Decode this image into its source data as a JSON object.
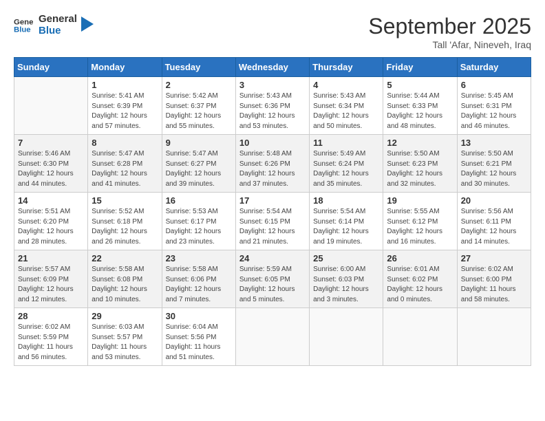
{
  "header": {
    "logo_line1": "General",
    "logo_line2": "Blue",
    "month": "September 2025",
    "location": "Tall 'Afar, Nineveh, Iraq"
  },
  "weekdays": [
    "Sunday",
    "Monday",
    "Tuesday",
    "Wednesday",
    "Thursday",
    "Friday",
    "Saturday"
  ],
  "weeks": [
    [
      {
        "day": null
      },
      {
        "day": 1,
        "info": "Sunrise: 5:41 AM\nSunset: 6:39 PM\nDaylight: 12 hours\nand 57 minutes."
      },
      {
        "day": 2,
        "info": "Sunrise: 5:42 AM\nSunset: 6:37 PM\nDaylight: 12 hours\nand 55 minutes."
      },
      {
        "day": 3,
        "info": "Sunrise: 5:43 AM\nSunset: 6:36 PM\nDaylight: 12 hours\nand 53 minutes."
      },
      {
        "day": 4,
        "info": "Sunrise: 5:43 AM\nSunset: 6:34 PM\nDaylight: 12 hours\nand 50 minutes."
      },
      {
        "day": 5,
        "info": "Sunrise: 5:44 AM\nSunset: 6:33 PM\nDaylight: 12 hours\nand 48 minutes."
      },
      {
        "day": 6,
        "info": "Sunrise: 5:45 AM\nSunset: 6:31 PM\nDaylight: 12 hours\nand 46 minutes."
      }
    ],
    [
      {
        "day": 7,
        "info": "Sunrise: 5:46 AM\nSunset: 6:30 PM\nDaylight: 12 hours\nand 44 minutes."
      },
      {
        "day": 8,
        "info": "Sunrise: 5:47 AM\nSunset: 6:28 PM\nDaylight: 12 hours\nand 41 minutes."
      },
      {
        "day": 9,
        "info": "Sunrise: 5:47 AM\nSunset: 6:27 PM\nDaylight: 12 hours\nand 39 minutes."
      },
      {
        "day": 10,
        "info": "Sunrise: 5:48 AM\nSunset: 6:26 PM\nDaylight: 12 hours\nand 37 minutes."
      },
      {
        "day": 11,
        "info": "Sunrise: 5:49 AM\nSunset: 6:24 PM\nDaylight: 12 hours\nand 35 minutes."
      },
      {
        "day": 12,
        "info": "Sunrise: 5:50 AM\nSunset: 6:23 PM\nDaylight: 12 hours\nand 32 minutes."
      },
      {
        "day": 13,
        "info": "Sunrise: 5:50 AM\nSunset: 6:21 PM\nDaylight: 12 hours\nand 30 minutes."
      }
    ],
    [
      {
        "day": 14,
        "info": "Sunrise: 5:51 AM\nSunset: 6:20 PM\nDaylight: 12 hours\nand 28 minutes."
      },
      {
        "day": 15,
        "info": "Sunrise: 5:52 AM\nSunset: 6:18 PM\nDaylight: 12 hours\nand 26 minutes."
      },
      {
        "day": 16,
        "info": "Sunrise: 5:53 AM\nSunset: 6:17 PM\nDaylight: 12 hours\nand 23 minutes."
      },
      {
        "day": 17,
        "info": "Sunrise: 5:54 AM\nSunset: 6:15 PM\nDaylight: 12 hours\nand 21 minutes."
      },
      {
        "day": 18,
        "info": "Sunrise: 5:54 AM\nSunset: 6:14 PM\nDaylight: 12 hours\nand 19 minutes."
      },
      {
        "day": 19,
        "info": "Sunrise: 5:55 AM\nSunset: 6:12 PM\nDaylight: 12 hours\nand 16 minutes."
      },
      {
        "day": 20,
        "info": "Sunrise: 5:56 AM\nSunset: 6:11 PM\nDaylight: 12 hours\nand 14 minutes."
      }
    ],
    [
      {
        "day": 21,
        "info": "Sunrise: 5:57 AM\nSunset: 6:09 PM\nDaylight: 12 hours\nand 12 minutes."
      },
      {
        "day": 22,
        "info": "Sunrise: 5:58 AM\nSunset: 6:08 PM\nDaylight: 12 hours\nand 10 minutes."
      },
      {
        "day": 23,
        "info": "Sunrise: 5:58 AM\nSunset: 6:06 PM\nDaylight: 12 hours\nand 7 minutes."
      },
      {
        "day": 24,
        "info": "Sunrise: 5:59 AM\nSunset: 6:05 PM\nDaylight: 12 hours\nand 5 minutes."
      },
      {
        "day": 25,
        "info": "Sunrise: 6:00 AM\nSunset: 6:03 PM\nDaylight: 12 hours\nand 3 minutes."
      },
      {
        "day": 26,
        "info": "Sunrise: 6:01 AM\nSunset: 6:02 PM\nDaylight: 12 hours\nand 0 minutes."
      },
      {
        "day": 27,
        "info": "Sunrise: 6:02 AM\nSunset: 6:00 PM\nDaylight: 11 hours\nand 58 minutes."
      }
    ],
    [
      {
        "day": 28,
        "info": "Sunrise: 6:02 AM\nSunset: 5:59 PM\nDaylight: 11 hours\nand 56 minutes."
      },
      {
        "day": 29,
        "info": "Sunrise: 6:03 AM\nSunset: 5:57 PM\nDaylight: 11 hours\nand 53 minutes."
      },
      {
        "day": 30,
        "info": "Sunrise: 6:04 AM\nSunset: 5:56 PM\nDaylight: 11 hours\nand 51 minutes."
      },
      {
        "day": null
      },
      {
        "day": null
      },
      {
        "day": null
      },
      {
        "day": null
      }
    ]
  ]
}
